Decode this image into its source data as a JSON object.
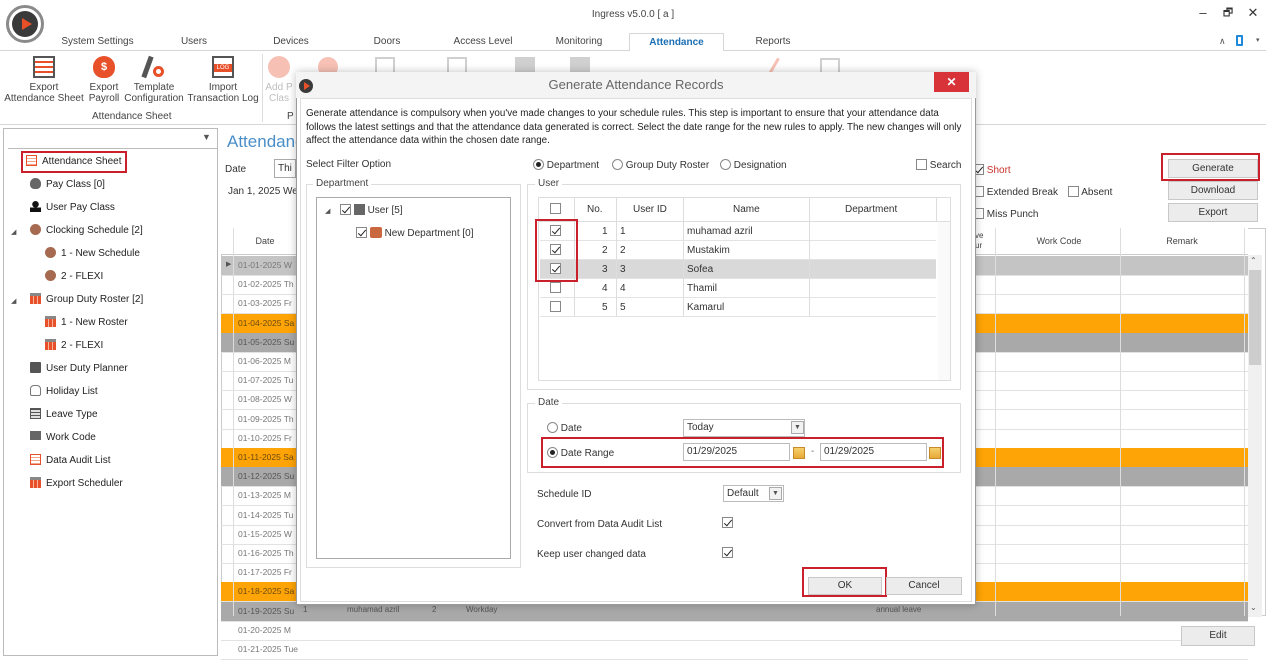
{
  "window": {
    "title": "Ingress v5.0.0 [ a ]",
    "controls": {
      "minimize": "–",
      "restore": "🗗",
      "close": "✕"
    }
  },
  "ribbon": {
    "tabs": [
      {
        "label": "System Settings",
        "active": false
      },
      {
        "label": "Users",
        "active": false
      },
      {
        "label": "Devices",
        "active": false
      },
      {
        "label": "Doors",
        "active": false
      },
      {
        "label": "Access Level",
        "active": false
      },
      {
        "label": "Monitoring",
        "active": false
      },
      {
        "label": "Attendance",
        "active": true
      },
      {
        "label": "Reports",
        "active": false
      }
    ],
    "buttons": [
      {
        "line1": "Export",
        "line2": "Attendance Sheet",
        "icon": "sheet-icon"
      },
      {
        "line1": "Export",
        "line2": "Payroll",
        "icon": "money-bag-icon"
      },
      {
        "line1": "Template",
        "line2": "Configuration",
        "icon": "tools-icon"
      },
      {
        "line1": "Import",
        "line2": "Transaction Log",
        "icon": "log-file-icon"
      },
      {
        "line1": "Add P",
        "line2": "Clas",
        "icon": "add-circle-icon"
      }
    ],
    "group_label": "Attendance Sheet",
    "group_label2": "P"
  },
  "sidebar": {
    "pin": "📌",
    "items": [
      {
        "label": "Attendance Sheet",
        "icon": "attendance-sheet-icon",
        "selected": true
      },
      {
        "label": "Pay Class [0]",
        "icon": "money-bag-icon"
      },
      {
        "label": "User Pay Class",
        "icon": "user-icon"
      },
      {
        "label": "Clocking Schedule [2]",
        "icon": "clock-icon",
        "expanded": true
      },
      {
        "label": "1 - New Schedule",
        "icon": "clock-icon"
      },
      {
        "label": "2 - FLEXI",
        "icon": "clock-icon"
      },
      {
        "label": "Group Duty Roster [2]",
        "icon": "roster-icon",
        "expanded": true
      },
      {
        "label": "1 - New Roster",
        "icon": "roster-icon"
      },
      {
        "label": "2 - FLEXI",
        "icon": "roster-icon"
      },
      {
        "label": "User Duty Planner",
        "icon": "briefcase-icon"
      },
      {
        "label": "Holiday List",
        "icon": "sandals-icon"
      },
      {
        "label": "Leave Type",
        "icon": "table-icon"
      },
      {
        "label": "Work Code",
        "icon": "monitor-icon"
      },
      {
        "label": "Data Audit List",
        "icon": "list-icon"
      },
      {
        "label": "Export Scheduler",
        "icon": "scheduler-icon"
      }
    ]
  },
  "main": {
    "title": "Attendanc",
    "date_label": "Date",
    "date_select": "Thi",
    "date_summary": "Jan 1, 2025 We",
    "filters": {
      "short": "Short",
      "extended_break": "Extended Break",
      "absent": "Absent",
      "miss_punch": "Miss Punch"
    },
    "buttons": {
      "generate": "Generate",
      "download": "Download",
      "export": "Export",
      "edit": "Edit"
    },
    "grid": {
      "headers": {
        "date": "Date",
        "leave_hour": "ve\nur",
        "work_code": "Work Code",
        "remark": "Remark"
      },
      "rows": [
        {
          "date": "01-01-2025 W",
          "type": "gray1"
        },
        {
          "date": "01-02-2025 Th",
          "type": "white"
        },
        {
          "date": "01-03-2025 Fr",
          "type": "white"
        },
        {
          "date": "01-04-2025 Sa",
          "type": "orange"
        },
        {
          "date": "01-05-2025 Su",
          "type": "gray"
        },
        {
          "date": "01-06-2025 M",
          "type": "white"
        },
        {
          "date": "01-07-2025 Tu",
          "type": "white"
        },
        {
          "date": "01-08-2025 W",
          "type": "white"
        },
        {
          "date": "01-09-2025 Th",
          "type": "white"
        },
        {
          "date": "01-10-2025 Fr",
          "type": "white"
        },
        {
          "date": "01-11-2025 Sa",
          "type": "orange"
        },
        {
          "date": "01-12-2025 Su",
          "type": "gray"
        },
        {
          "date": "01-13-2025 M",
          "type": "white"
        },
        {
          "date": "01-14-2025 Tu",
          "type": "white"
        },
        {
          "date": "01-15-2025 W",
          "type": "white"
        },
        {
          "date": "01-16-2025 Th",
          "type": "white"
        },
        {
          "date": "01-17-2025 Fr",
          "type": "white"
        },
        {
          "date": "01-18-2025 Sa",
          "type": "orange"
        },
        {
          "date": "01-19-2025 Su",
          "type": "gray"
        },
        {
          "date": "01-20-2025 M",
          "type": "white"
        },
        {
          "date": "01-21-2025 Tue",
          "type": "white"
        }
      ],
      "last_row": {
        "col1": "1",
        "name": "muhamad azril",
        "col3": "2",
        "day_type": "Workday",
        "remark": "annual leave"
      }
    }
  },
  "dialog": {
    "title": "Generate Attendance Records",
    "close": "✕",
    "description": "Generate attendance is compulsory when you've made changes to your schedule rules. This step is important to ensure that your attendance data follows the latest settings and that the attendance data generated is correct. Select the date range for the new rules to apply. The new changes will only affect the attendance data within the chosen date range.",
    "filter_label": "Select Filter Option",
    "filter_options": [
      {
        "label": "Department",
        "selected": true
      },
      {
        "label": "Group Duty Roster",
        "selected": false
      },
      {
        "label": "Designation",
        "selected": false
      }
    ],
    "search_label": "Search",
    "department_legend": "Department",
    "tree": [
      {
        "label": "User [5]",
        "checked": true
      },
      {
        "label": "New Department [0]",
        "checked": true
      }
    ],
    "user_legend": "User",
    "user_table": {
      "headers": {
        "no": "No.",
        "user_id": "User ID",
        "name": "Name",
        "department": "Department"
      },
      "rows": [
        {
          "checked": true,
          "no": "1",
          "user_id": "1",
          "name": "muhamad azril",
          "department": ""
        },
        {
          "checked": true,
          "no": "2",
          "user_id": "2",
          "name": "Mustakim",
          "department": ""
        },
        {
          "checked": true,
          "no": "3",
          "user_id": "3",
          "name": "Sofea",
          "department": ""
        },
        {
          "checked": false,
          "no": "4",
          "user_id": "4",
          "name": "Thamil",
          "department": ""
        },
        {
          "checked": false,
          "no": "5",
          "user_id": "5",
          "name": "Kamarul",
          "department": ""
        }
      ]
    },
    "date_legend": "Date",
    "date_option_label": "Date",
    "date_option_value": "Today",
    "date_range_label": "Date Range",
    "date_from": "01/29/2025",
    "date_sep": "-",
    "date_to": "01/29/2025",
    "schedule_id_label": "Schedule ID",
    "schedule_id_value": "Default",
    "convert_label": "Convert from Data Audit List",
    "convert_checked": true,
    "keep_label": "Keep user changed data",
    "keep_checked": true,
    "ok_label": "OK",
    "cancel_label": "Cancel"
  },
  "colors": {
    "accent": "#1a6fb5",
    "highlight": "#c9202b",
    "weekend_orange": "#ffa406",
    "weekend_gray": "#a9a9a9",
    "close_red": "#d9333a"
  }
}
